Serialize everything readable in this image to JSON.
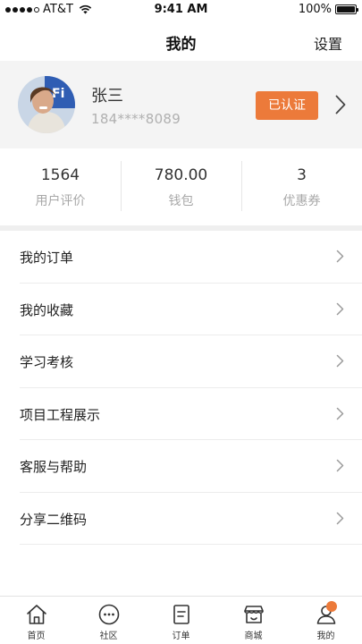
{
  "status_bar": {
    "carrier": "AT&T",
    "time": "9:41 AM",
    "battery": "100%"
  },
  "nav": {
    "title": "我的",
    "settings": "设置"
  },
  "profile": {
    "name": "张三",
    "phone": "184****8089",
    "verified_badge": "已认证"
  },
  "stats": [
    {
      "value": "1564",
      "label": "用户评价"
    },
    {
      "value": "780.00",
      "label": "钱包"
    },
    {
      "value": "3",
      "label": "优惠券"
    }
  ],
  "menu": [
    {
      "label": "我的订单"
    },
    {
      "label": "我的收藏"
    },
    {
      "label": "学习考核"
    },
    {
      "label": "项目工程展示"
    },
    {
      "label": "客服与帮助"
    },
    {
      "label": "分享二维码"
    }
  ],
  "tabs": [
    {
      "label": "首页",
      "icon": "home-icon"
    },
    {
      "label": "社区",
      "icon": "community-icon"
    },
    {
      "label": "订单",
      "icon": "order-icon"
    },
    {
      "label": "商城",
      "icon": "store-icon"
    },
    {
      "label": "我的",
      "icon": "profile-icon"
    }
  ],
  "colors": {
    "accent": "#ec7a3a",
    "profile_bg": "#f4f4f4",
    "muted_text": "#a8a8a8"
  }
}
